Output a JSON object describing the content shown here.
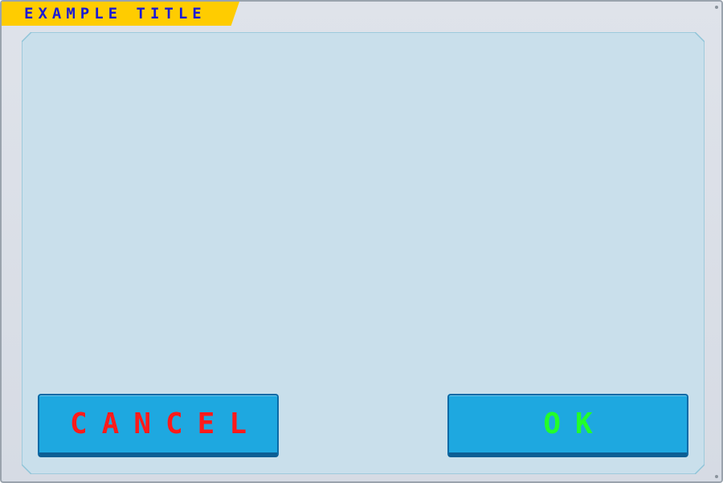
{
  "dialog": {
    "title": "EXAMPLE TITLE",
    "colors": {
      "title_tab": "#ffcc00",
      "title_text": "#1a1ad6",
      "frame": "#d6dbe4",
      "panel": "#c9dfeb",
      "panel_border": "#8fc4d8",
      "button": "#1ea8e0"
    }
  },
  "buttons": {
    "cancel": {
      "label": "CANCEL",
      "color": "#ff1a1a"
    },
    "ok": {
      "label": "OK",
      "color": "#22ff2a"
    }
  }
}
